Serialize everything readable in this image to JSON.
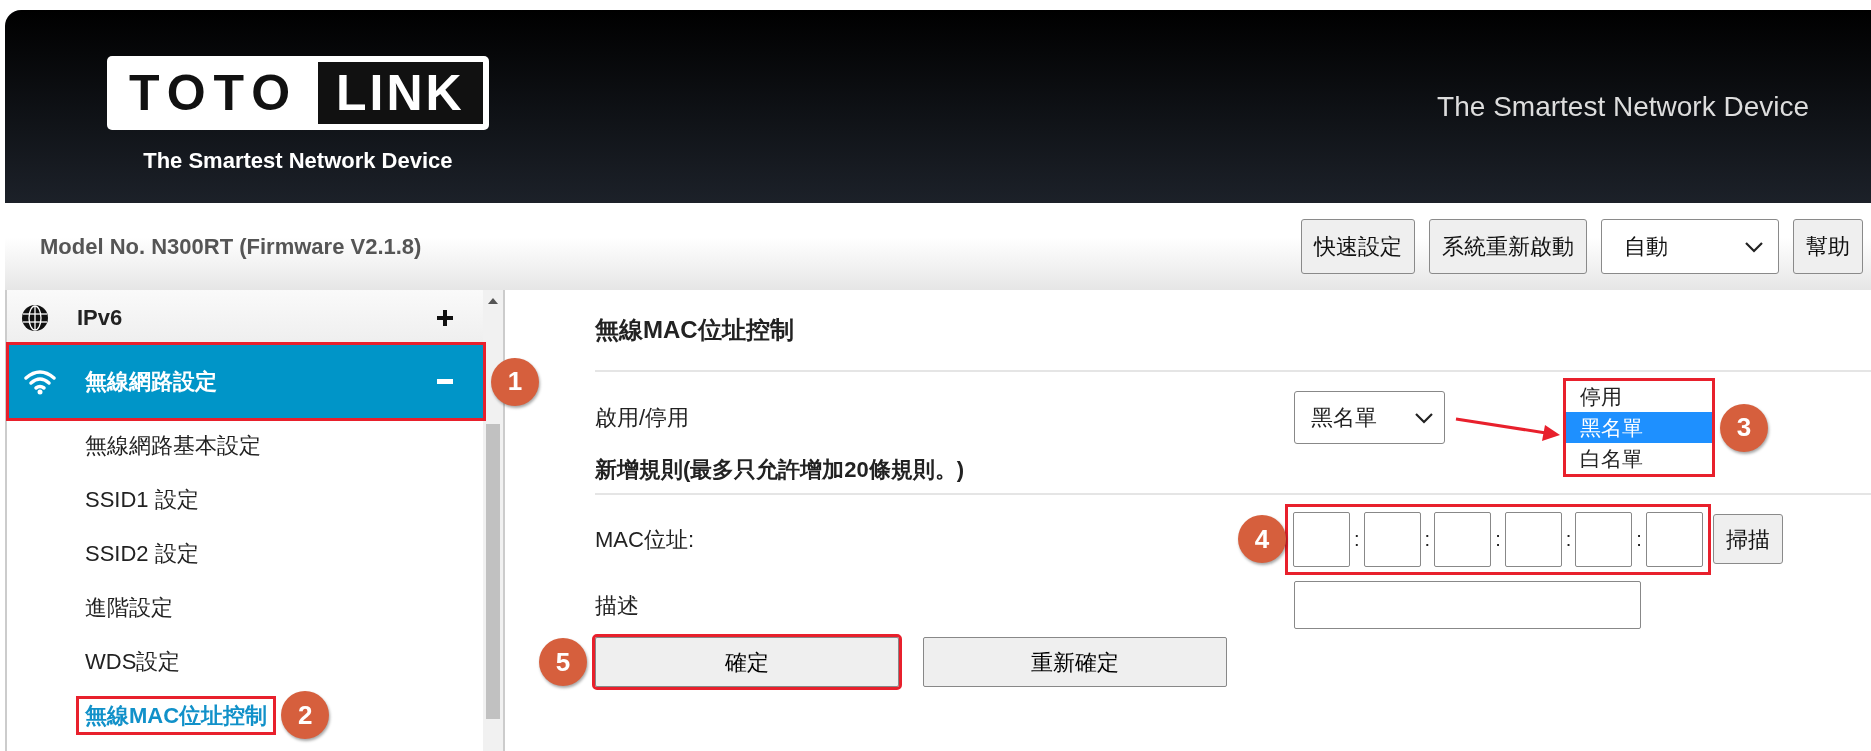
{
  "header": {
    "logo": {
      "word_1": "TOTO",
      "word_2": "LINK",
      "tagline": "The Smartest Network Device"
    },
    "tagline": "The Smartest Network Device"
  },
  "toolbar": {
    "model": "Model No. N300RT (Firmware V2.1.8)",
    "controls": [
      {
        "kind": "button",
        "label": "快速設定"
      },
      {
        "kind": "button",
        "label": "系統重新啟動"
      },
      {
        "kind": "select",
        "value": "自動"
      },
      {
        "kind": "button",
        "label": "幫助"
      }
    ]
  },
  "sidebar": {
    "sections": [
      {
        "label": "IPv6",
        "expanded": false,
        "selected": false
      },
      {
        "label": "無線網路設定",
        "expanded": true,
        "selected": true,
        "callout": "1",
        "children": [
          {
            "label": "無線網路基本設定",
            "selected": false
          },
          {
            "label": "SSID1 設定",
            "selected": false
          },
          {
            "label": "SSID2 設定",
            "selected": false
          },
          {
            "label": "進階設定",
            "selected": false
          },
          {
            "label": "WDS設定",
            "selected": false
          },
          {
            "label": "無線MAC位址控制",
            "selected": true,
            "callout": "2"
          }
        ]
      }
    ]
  },
  "content": {
    "title": "無線MAC位址控制",
    "rows": [
      {
        "kind": "select",
        "label": "啟用/停用",
        "value": "黑名單",
        "menu": {
          "callout": "3",
          "options": [
            {
              "label": "停用",
              "selected": false
            },
            {
              "label": "黑名單",
              "selected": true
            },
            {
              "label": "白名單",
              "selected": false
            }
          ]
        }
      },
      {
        "kind": "heading",
        "label": "新增規則(最多只允許增加20條規則。)"
      },
      {
        "kind": "mac",
        "label": "MAC位址:",
        "callout": "4",
        "octets": [
          {
            "kind": "octet",
            "separator": ":"
          },
          {
            "kind": "octet",
            "separator": ":"
          },
          {
            "kind": "octet",
            "separator": ":"
          },
          {
            "kind": "octet",
            "separator": ":"
          },
          {
            "kind": "octet",
            "separator": ":"
          },
          {
            "kind": "octet"
          }
        ],
        "button": "掃描"
      },
      {
        "kind": "text",
        "label": "描述"
      }
    ],
    "buttons": [
      {
        "label": "確定",
        "callout": "5"
      },
      {
        "label": "重新確定"
      }
    ]
  }
}
